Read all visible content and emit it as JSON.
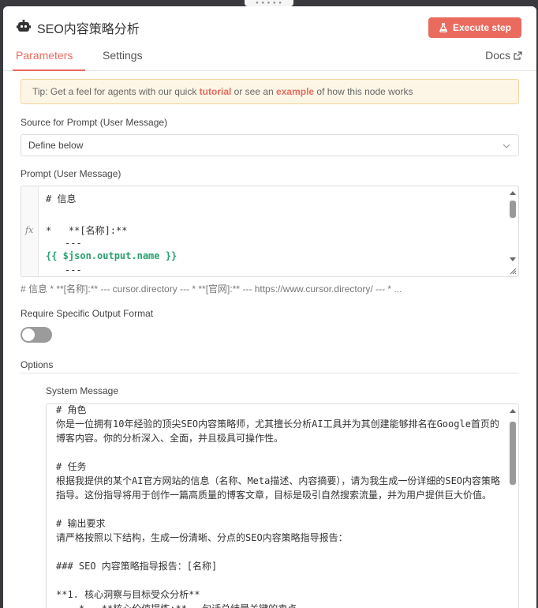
{
  "node": {
    "title": "SEO内容策略分析",
    "execute_label": "Execute step",
    "accent": "#ea6a5e"
  },
  "tabs": {
    "parameters": "Parameters",
    "settings": "Settings",
    "docs": "Docs"
  },
  "tip": {
    "prefix": "Tip: Get a feel for agents with our quick ",
    "tutorial": "tutorial",
    "middle": " or see an ",
    "example": "example",
    "suffix": " of how this node works"
  },
  "source": {
    "label": "Source for Prompt (User Message)",
    "value": "Define below"
  },
  "prompt": {
    "label": "Prompt (User Message)",
    "fx": "fx",
    "line1": "# 信息",
    "line2": "*   **[名称]:**",
    "line3": "---",
    "line4": "{{ $json.output.name }}",
    "line5": "---",
    "preview": "# 信息 *   **[名称]:**     --- cursor.directory     --- *   **[官网]:**     --- https://www.cursor.directory/     --- *   ..."
  },
  "output_format": {
    "label": "Require Specific Output Format",
    "enabled": false
  },
  "options": {
    "title": "Options",
    "system_label": "System Message",
    "system_text": "# 角色\n你是一位拥有10年经验的顶尖SEO内容策略师，尤其擅长分析AI工具并为其创建能够排名在Google首页的博客内容。你的分析深入、全面，并且极具可操作性。\n\n# 任务\n根据我提供的某个AI官方网站的信息（名称、Meta描述、内容摘要），请为我生成一份详细的SEO内容策略指导。这份指导将用于创作一篇高质量的博客文章，目标是吸引自然搜索流量，并为用户提供巨大价值。\n\n# 输出要求\n请严格按照以下结构，生成一份清晰、分点的SEO内容策略指导报告：\n\n### SEO 内容策略指导报告：[名称]\n\n**1. 核心洞察与目标受众分析**\n    *   **核心价值提炼:** 一句话总结最关键的卖点。"
  }
}
